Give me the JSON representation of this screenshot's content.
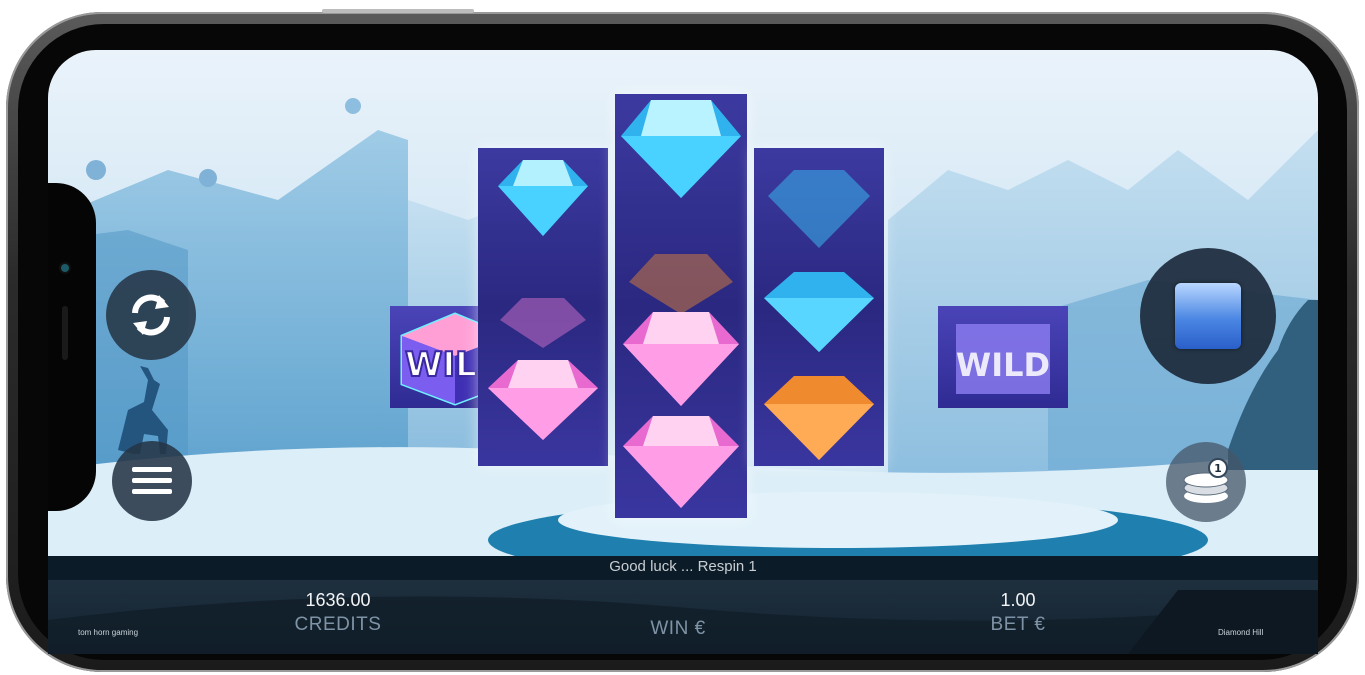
{
  "game": {
    "message": "Good luck ... Respin 1",
    "credits_value": "1636.00",
    "credits_label": "CREDITS",
    "win_label": "WIN €",
    "bet_value": "1.00",
    "bet_label": "BET €",
    "provider": "tom horn gaming",
    "title": "Diamond Hill",
    "wild_text": "WILD"
  },
  "controls": {
    "autoplay_icon": "refresh-icon",
    "menu_icon": "hamburger-menu-icon",
    "spin_icon": "stop-square-icon",
    "bet_icon": "coin-stack-icon",
    "bet_badge": "1"
  },
  "reels": [
    {
      "symbols": [
        "wild"
      ]
    },
    {
      "symbols": [
        "blue-diamond",
        "pink-diamond-faded",
        "pink-diamond"
      ]
    },
    {
      "symbols": [
        "blue-diamond",
        "orange-diamond-faded",
        "pink-diamond",
        "pink-diamond"
      ]
    },
    {
      "symbols": [
        "blue-diamond-faded",
        "blue-diamond",
        "orange-diamond"
      ]
    },
    {
      "symbols": [
        "wild-blurred"
      ]
    }
  ],
  "colors": {
    "blue_gem": "#3fb6ef",
    "pink_gem": "#e86ad0",
    "orange_gem": "#f08a2e",
    "reel_bg": "#2f2b93",
    "panel_bg": "#142330"
  }
}
